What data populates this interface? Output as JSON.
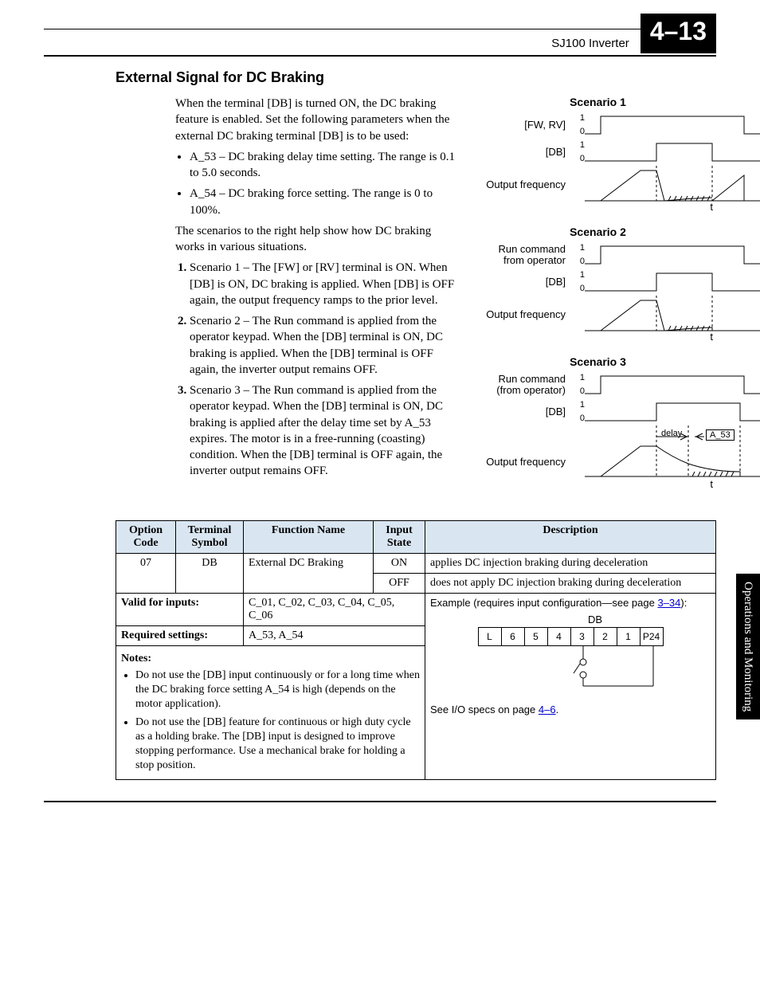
{
  "header": {
    "doc": "SJ100 Inverter",
    "pagenum": "4–13"
  },
  "section_title": "External Signal for DC Braking",
  "intro": "When the terminal [DB] is turned ON, the DC braking feature is enabled. Set the following parameters when the external DC braking terminal [DB] is to be used:",
  "bullets": [
    "A_53 – DC braking delay time setting. The range is 0.1 to 5.0 seconds.",
    "A_54 – DC braking force setting. The range is 0 to 100%."
  ],
  "mid": "The scenarios to the right help show how DC braking works in various situations.",
  "scenarios_list": [
    "Scenario 1 – The [FW] or [RV] terminal is ON. When [DB] is ON, DC braking is applied. When [DB] is OFF again, the output frequency ramps to the prior level.",
    "Scenario 2 – The Run command is applied from the operator keypad. When the [DB] terminal is ON, DC braking is applied. When the [DB] terminal is OFF again, the inverter output remains OFF.",
    "Scenario 3 – The Run command is applied from the operator keypad. When the [DB] terminal is ON, DC braking is applied after the delay time set by A_53 expires. The motor is in a free-running (coasting) condition. When the [DB] terminal is OFF again, the inverter output remains OFF."
  ],
  "diagrams": {
    "s1": {
      "title": "Scenario 1",
      "r1": "[FW, RV]",
      "r2": "[DB]",
      "r3": "Output frequency",
      "t": "t"
    },
    "s2": {
      "title": "Scenario 2",
      "r1": "Run command from operator",
      "r2": "[DB]",
      "r3": "Output frequency",
      "t": "t"
    },
    "s3": {
      "title": "Scenario 3",
      "r1": "Run command (from operator)",
      "r2": "[DB]",
      "r3": "Output frequency",
      "t": "t",
      "delay": "delay",
      "a53": "A_53"
    }
  },
  "table": {
    "h": {
      "c1": "Option Code",
      "c2": "Terminal Symbol",
      "c3": "Function Name",
      "c4": "Input State",
      "c5": "Description"
    },
    "r1": {
      "code": "07",
      "sym": "DB",
      "fn": "External DC Braking",
      "st_on": "ON",
      "d_on": "applies DC injection braking during deceleration",
      "st_off": "OFF",
      "d_off": "does not apply DC injection braking during deceleration"
    },
    "valid_label": "Valid for inputs:",
    "valid_val": "C_01, C_02, C_03, C_04, C_05, C_06",
    "req_label": "Required settings:",
    "req_val": "A_53, A_54",
    "example_pre": "Example (requires input configuration—see page ",
    "example_link": "3–34",
    "example_post": "):",
    "notes_h": "Notes:",
    "notes": [
      "Do not use the [DB] input continuously or for a long time when the DC braking force setting A_54 is high (depends on the motor application).",
      "Do not use the [DB] feature for continuous or high duty cycle as a holding brake. The [DB] input is designed to improve stopping performance. Use a mechanical brake for holding a stop position."
    ],
    "terminals": {
      "db": "DB",
      "cells": [
        "L",
        "6",
        "5",
        "4",
        "3",
        "2",
        "1",
        "P24"
      ]
    },
    "see_io_pre": "See I/O specs on page ",
    "see_io_link": "4–6",
    "see_io_post": "."
  },
  "side_tab": "Operations and Monitoring"
}
